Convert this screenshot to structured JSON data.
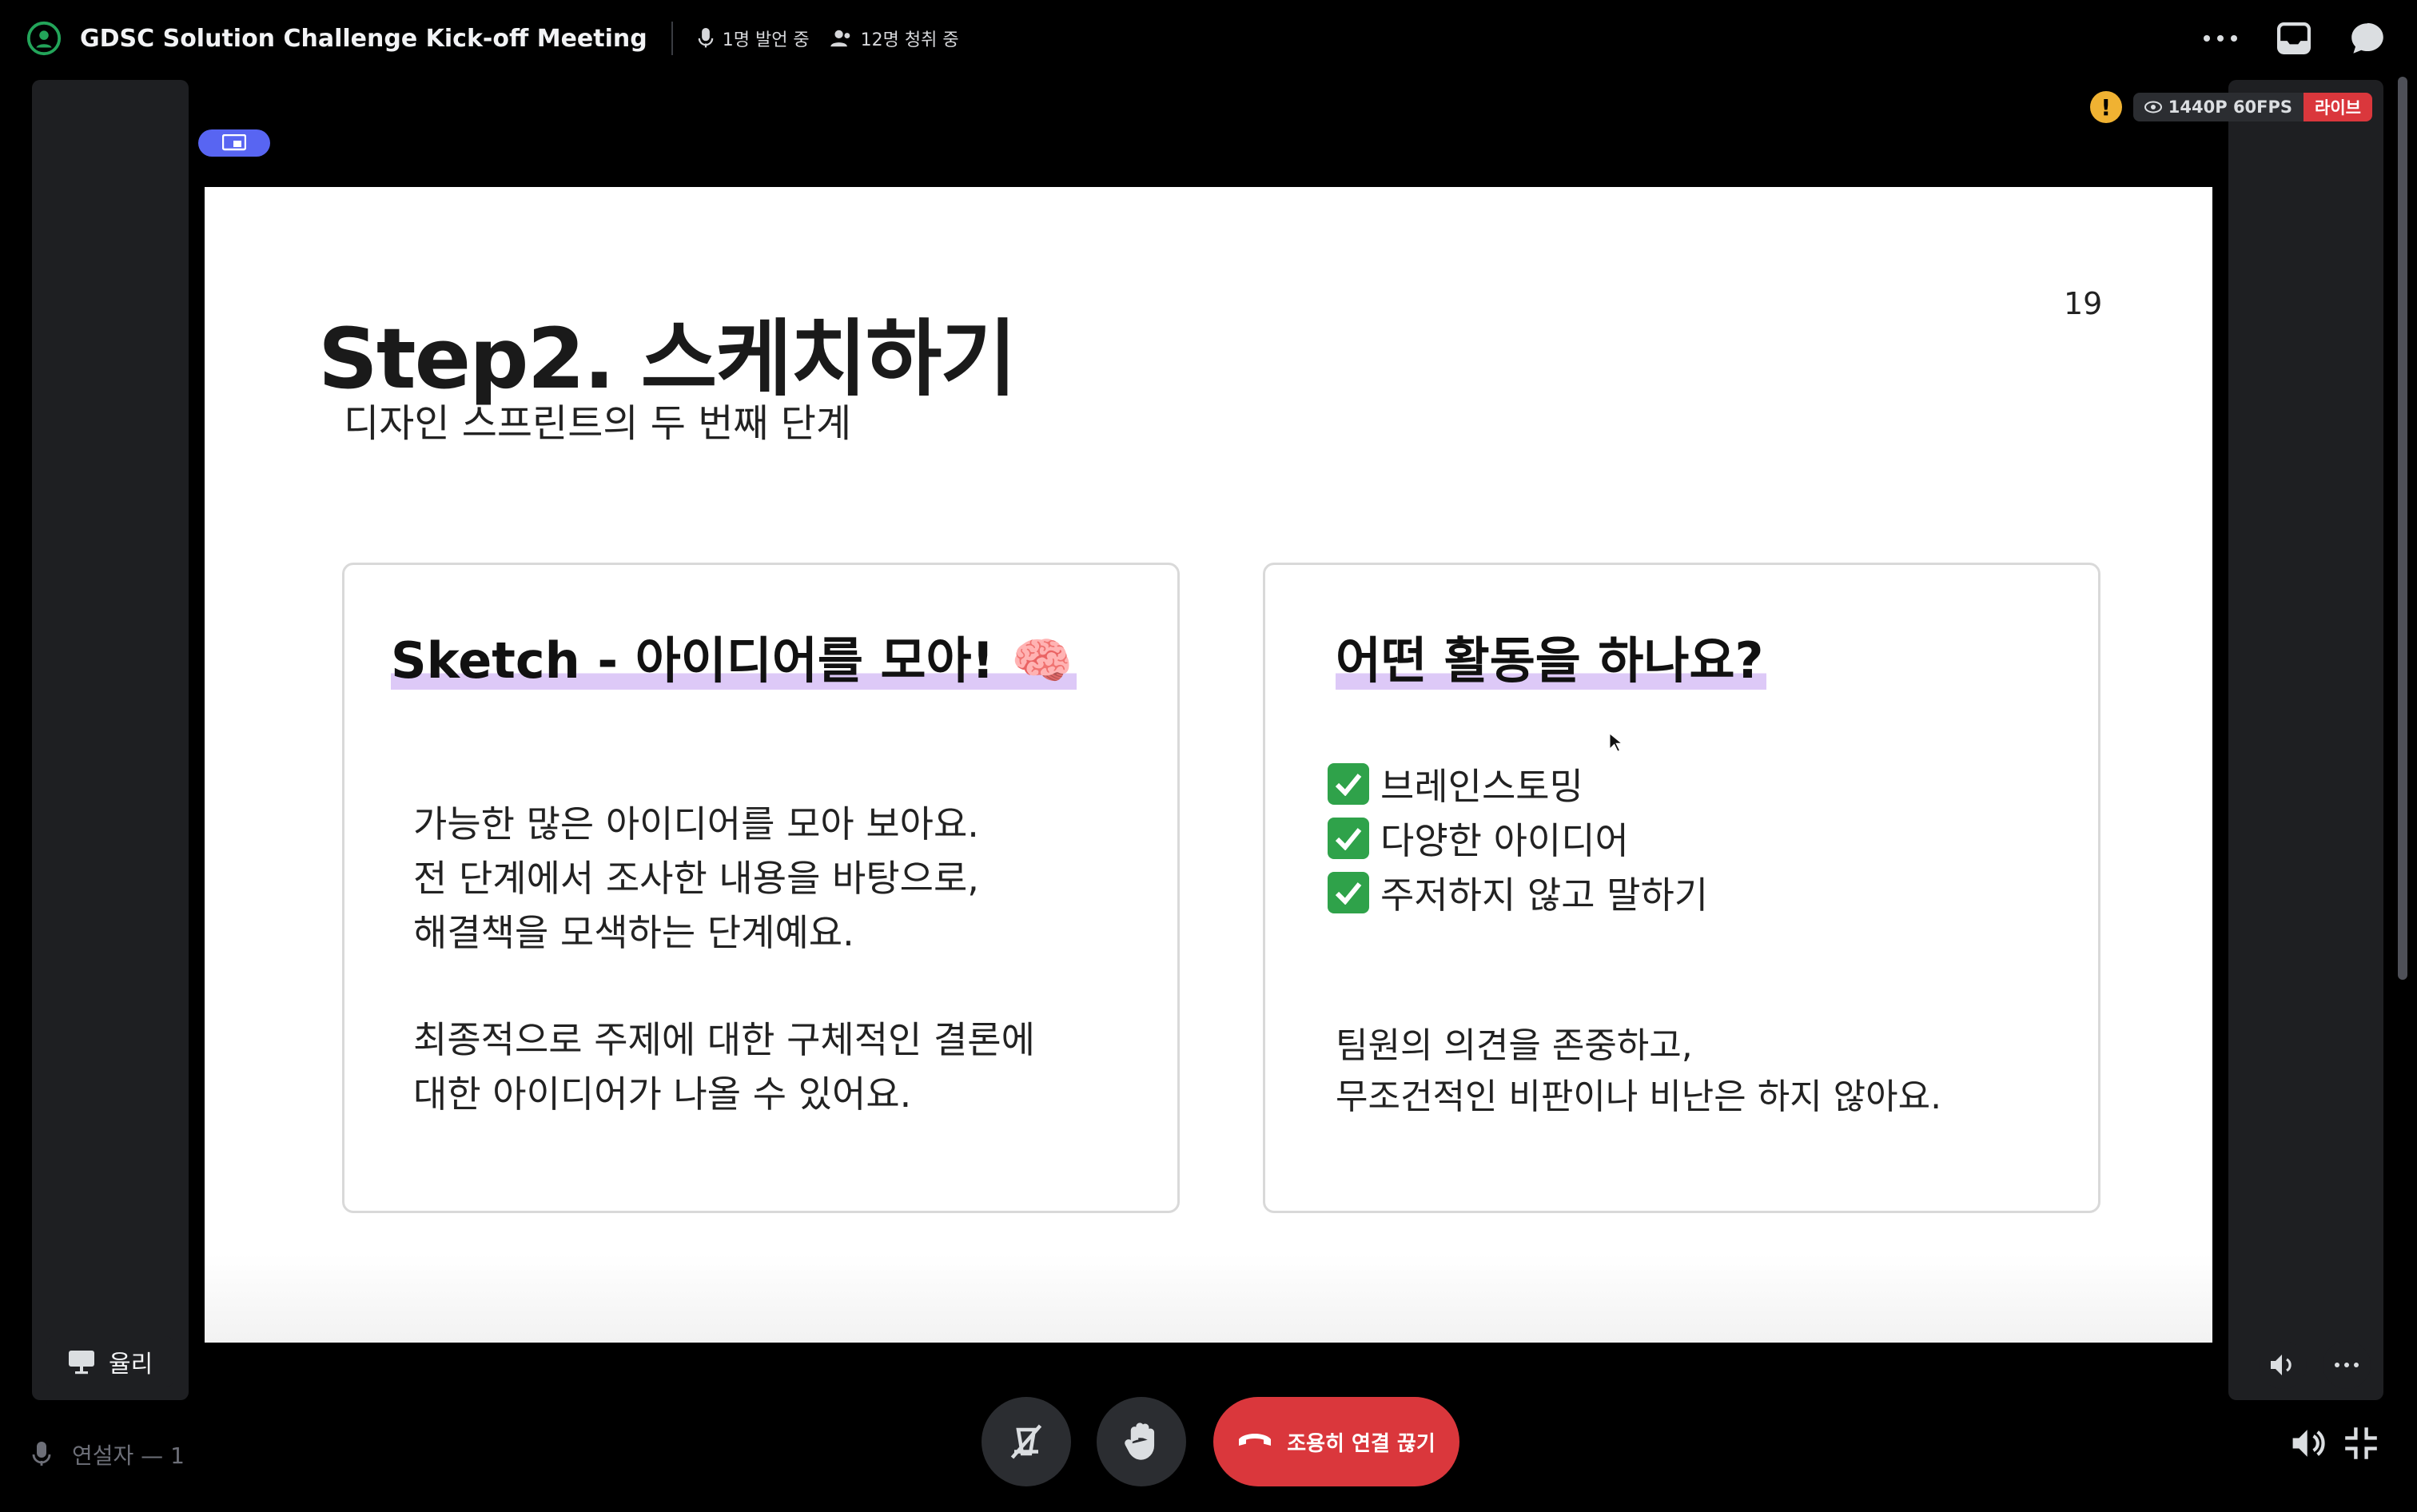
{
  "topbar": {
    "title": "GDSC Solution Challenge Kick-off Meeting",
    "speaking": "1명 발언 중",
    "listening": "12명 청취 중",
    "icons": [
      "stage-icon",
      "mic-icon",
      "listeners-icon",
      "more-icon",
      "inbox-icon",
      "chat-icon"
    ]
  },
  "stream": {
    "quality": "1440P 60FPS",
    "live": "라이브",
    "warning": "!"
  },
  "slide": {
    "title": "Step2. 스케치하기",
    "subtitle": "디자인 스프린트의 두 번째 단계",
    "page_number": "19",
    "left_card": {
      "heading": "Sketch - 아이디어를 모아! 🧠",
      "p1_l1": "가능한 많은 아이디어를 모아 보아요.",
      "p1_l2": "전 단계에서 조사한 내용을 바탕으로,",
      "p1_l3": "해결책을 모색하는 단계예요.",
      "p2_l1": "최종적으로 주제에 대한 구체적인 결론에",
      "p2_l2": "대한 아이디어가 나올 수 있어요."
    },
    "right_card": {
      "heading": "어떤 활동을 하나요?",
      "checks": [
        "브레인스토밍",
        "다양한 아이디어",
        "주저하지 않고 말하기"
      ],
      "p_l1": "팀원의 의견을 존중하고,",
      "p_l2": "무조건적인 비판이나 비난은 하지 않아요."
    }
  },
  "presenter": {
    "name": "율리"
  },
  "speakers_label": "연설자 — 1",
  "controls": {
    "disconnect_label": "조용히 연결 끊기"
  },
  "colors": {
    "background": "#000000",
    "panel": "#1e1f22",
    "blurple": "#5865f2",
    "danger": "#da373c",
    "warning": "#f0b232",
    "highlight": "#ddc9f7",
    "check_green": "#2fa24a"
  }
}
